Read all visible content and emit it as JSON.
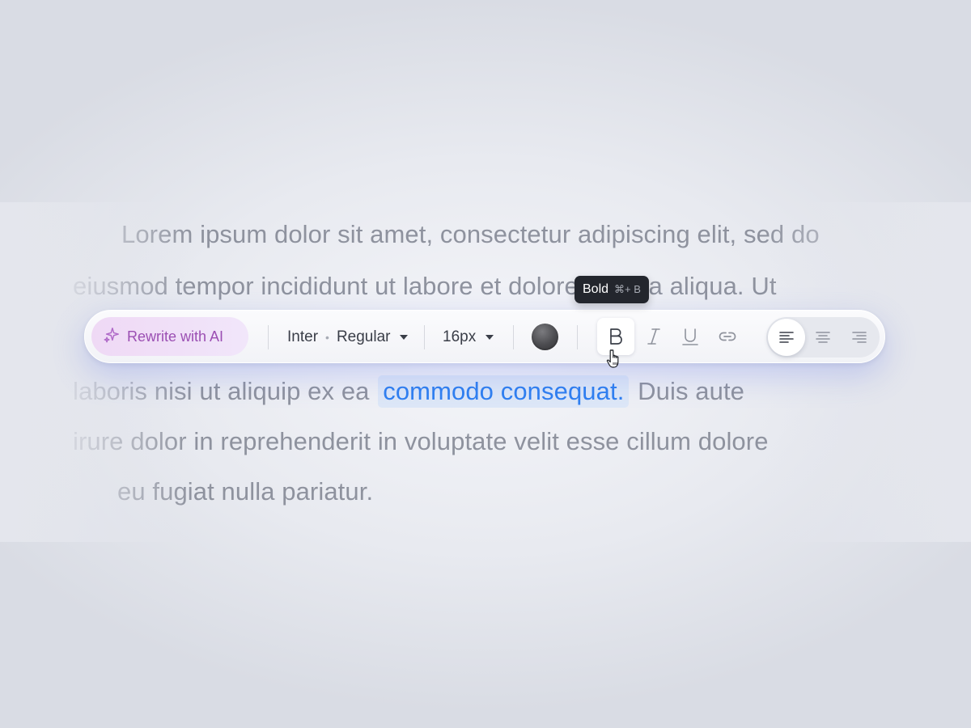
{
  "document": {
    "line1": "Lorem ipsum dolor sit amet, consectetur adipiscing elit, sed do",
    "line2": "eiusmod tempor incididunt ut labore et dolore magna aliqua. Ut",
    "line3_before": "laboris nisi ut aliquip ex ea",
    "line3_selected": "commodo consequat.",
    "line3_after": "Duis aute",
    "line4": "irure dolor in reprehenderit in voluptate velit esse cillum dolore",
    "line5": "eu fugiat nulla pariatur."
  },
  "toolbar": {
    "ai_button": {
      "label": "Rewrite with AI",
      "icon": "sparkle-icon",
      "color": "#9b4fb3"
    },
    "font_family": "Inter",
    "font_weight": "Regular",
    "font_size": "16px",
    "text_color": "#4b4b4f",
    "formatting": [
      {
        "name": "bold",
        "icon": "bold-icon",
        "active": true
      },
      {
        "name": "italic",
        "icon": "italic-icon",
        "active": false
      },
      {
        "name": "underline",
        "icon": "underline-icon",
        "active": false
      },
      {
        "name": "link",
        "icon": "link-icon",
        "active": false
      }
    ],
    "alignment": [
      {
        "name": "left",
        "icon": "align-left-icon",
        "active": true
      },
      {
        "name": "center",
        "icon": "align-center-icon",
        "active": false
      },
      {
        "name": "right",
        "icon": "align-right-icon",
        "active": false
      }
    ]
  },
  "tooltip": {
    "label": "Bold",
    "shortcut": "⌘+ B"
  },
  "colors": {
    "selection_text": "#2f7ff0",
    "selection_bg": "#dde7f7",
    "accent_glow": "#586eeb"
  }
}
